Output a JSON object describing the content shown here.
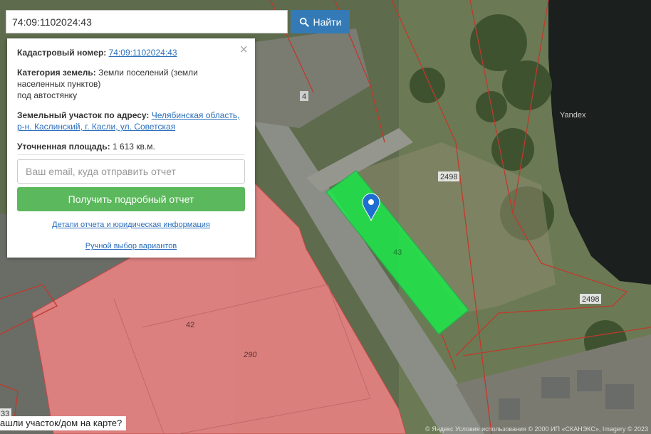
{
  "search": {
    "value": "74:09:1102024:43",
    "button_label": "Найти"
  },
  "card": {
    "cadastral_label": "Кадастровый номер:",
    "cadastral_value": "74:09:1102024:43",
    "category_label": "Категория земель:",
    "category_value_line1": "Земли поселений (земли",
    "category_value_line2": "населенных пунктов)",
    "category_value_line3": "под автостянку",
    "address_label": "Земельный участок по адресу:",
    "address_line1": "Челябинская область,",
    "address_line2": "р-н. Каслинский, г. Касли, ул. Советская",
    "area_label": "Уточненная площадь:",
    "area_value": "1 613 кв.м.",
    "email_placeholder": "Ваш email, куда отправить отчет",
    "report_button": "Получить подробный отчет",
    "details_link": "Детали отчета и юридическая информация",
    "manual_link": "Ручной выбор вариантов"
  },
  "map": {
    "labels": {
      "n4": "4",
      "n2498_top": "2498",
      "n2498_bottom": "2498",
      "n42": "42",
      "n290": "290",
      "n43": "43",
      "n33": "33"
    },
    "watermark": "Yandex",
    "footer_question": "ашли участок/дом на карте?",
    "attribution": "© Яндекс Условия использования © 2000 ИП «СКАНЭКС», Imagery © 2023"
  },
  "colors": {
    "selected_parcel": "#1ee84a",
    "building": "#e88282",
    "pin": "#1f6fd1",
    "accent": "#337ab7",
    "report_button": "#5cb85c"
  }
}
